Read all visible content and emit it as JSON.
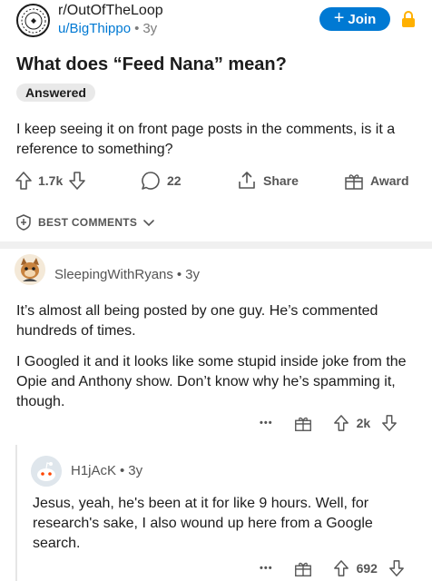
{
  "post": {
    "subreddit": "r/OutOfTheLoop",
    "author": "u/BigThippo",
    "age": "3y",
    "join_label": "Join",
    "title": "What does “Feed Nana” mean?",
    "flair": "Answered",
    "body": "I keep seeing it on front page posts in the comments, is it a reference to something?",
    "votes": "1.7k",
    "comments": "22",
    "share_label": "Share",
    "award_label": "Award"
  },
  "sort": {
    "label": "BEST COMMENTS"
  },
  "comments": [
    {
      "author": "SleepingWithRyans",
      "age": "3y",
      "paragraphs": [
        "It’s almost all being posted by one guy. He’s commented hundreds of times.",
        "I Googled it and it looks like some stupid inside joke from the Opie and Anthony show. Don’t know why he’s spamming it, though."
      ],
      "votes": "2k"
    },
    {
      "author": "H1jAcK",
      "age": "3y",
      "paragraphs": [
        "Jesus, yeah, he's been at it for like 9 hours. Well, for research's sake, I also wound up here from a Google search."
      ],
      "votes": "692"
    }
  ],
  "ui": {
    "more_glyph": "•••",
    "dot_separator": "•",
    "accent_color": "#0079d3",
    "lock_color": "#ffb000",
    "icons": [
      "subreddit-avatar-icon",
      "lock-icon",
      "upvote-icon",
      "downvote-icon",
      "comment-icon",
      "share-icon",
      "award-icon",
      "shield-icon",
      "chevron-down-icon",
      "more-icon",
      "avatar-icon"
    ]
  }
}
